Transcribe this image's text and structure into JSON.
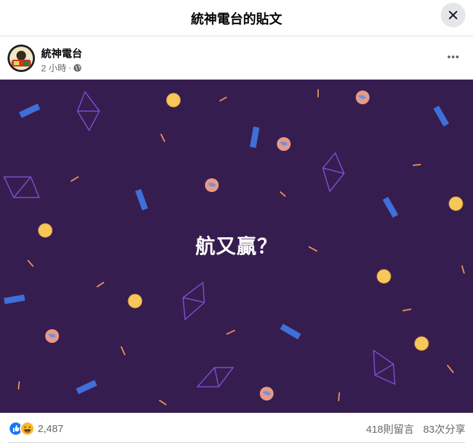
{
  "header": {
    "title": "統神電台的貼文",
    "close_icon": "close-icon"
  },
  "post": {
    "author": "統神電台",
    "time": "2 小時",
    "separator": "·",
    "privacy_icon": "globe-icon",
    "more_icon": "more-horizontal-icon",
    "text": "航又贏？",
    "background_color": "#361d4f"
  },
  "footer": {
    "reaction_icons": [
      "like-icon",
      "haha-icon"
    ],
    "reaction_count": "2,487",
    "comments": "418則留言",
    "shares": "83次分享"
  },
  "colors": {
    "like": "#1877f2",
    "haha": "#f7b928",
    "secondary_text": "#65676b"
  }
}
